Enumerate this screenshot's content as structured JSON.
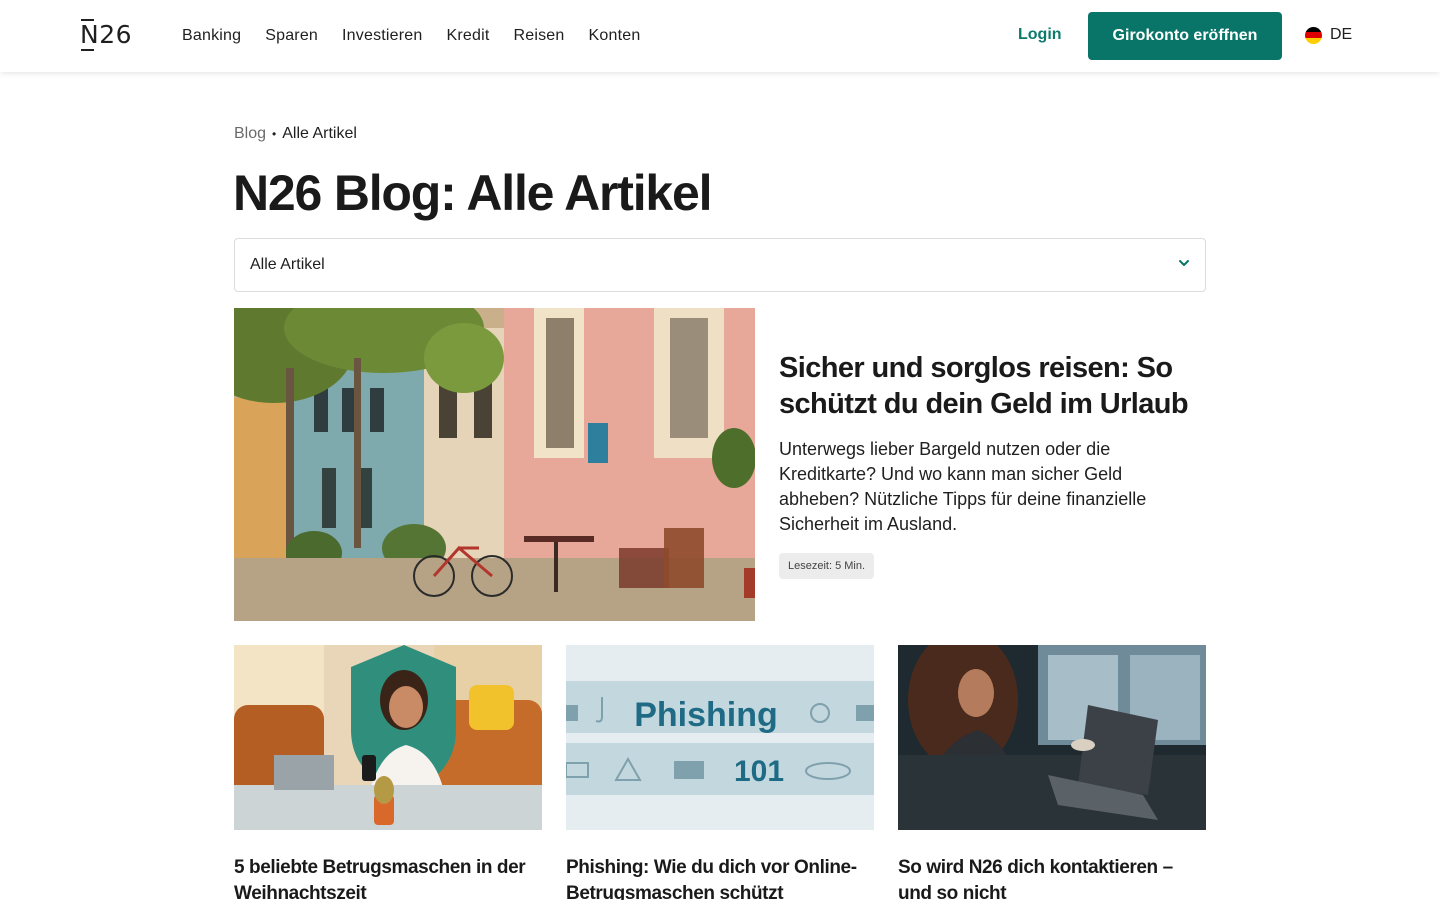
{
  "header": {
    "logo": "N26",
    "nav": [
      "Banking",
      "Sparen",
      "Investieren",
      "Kredit",
      "Reisen",
      "Konten"
    ],
    "login": "Login",
    "cta": "Girokonto eröffnen",
    "language": "DE"
  },
  "breadcrumb": {
    "link": "Blog",
    "separator": "•",
    "current": "Alle Artikel"
  },
  "page_title": "N26 Blog: Alle Artikel",
  "filter": {
    "selected": "Alle Artikel"
  },
  "featured": {
    "title": "Sicher und sorglos reisen: So schützt du dein Geld im Urlaub",
    "description": "Unterwegs lieber Bargeld nutzen oder die Kreditkarte? Und wo kann man sicher Geld abheben? Nützliche Tipps für deine finanzielle Sicherheit im Ausland.",
    "reading_time": "Lesezeit: 5 Min."
  },
  "cards": [
    {
      "title": "5 beliebte Betrugsmaschen in der Weihnachtszeit"
    },
    {
      "title": "Phishing: Wie du dich vor Online-Betrugsmaschen schützt",
      "image_text": [
        "Phishing",
        "101"
      ]
    },
    {
      "title": "So wird N26 dich kontaktieren – und so nicht"
    }
  ],
  "colors": {
    "brand": "#097568",
    "login": "#0d7a6c",
    "flag": [
      "#000000",
      "#dd0000",
      "#ffce00"
    ]
  },
  "icons": {
    "select": "chevron-down-icon",
    "language": "germany-flag-icon"
  }
}
